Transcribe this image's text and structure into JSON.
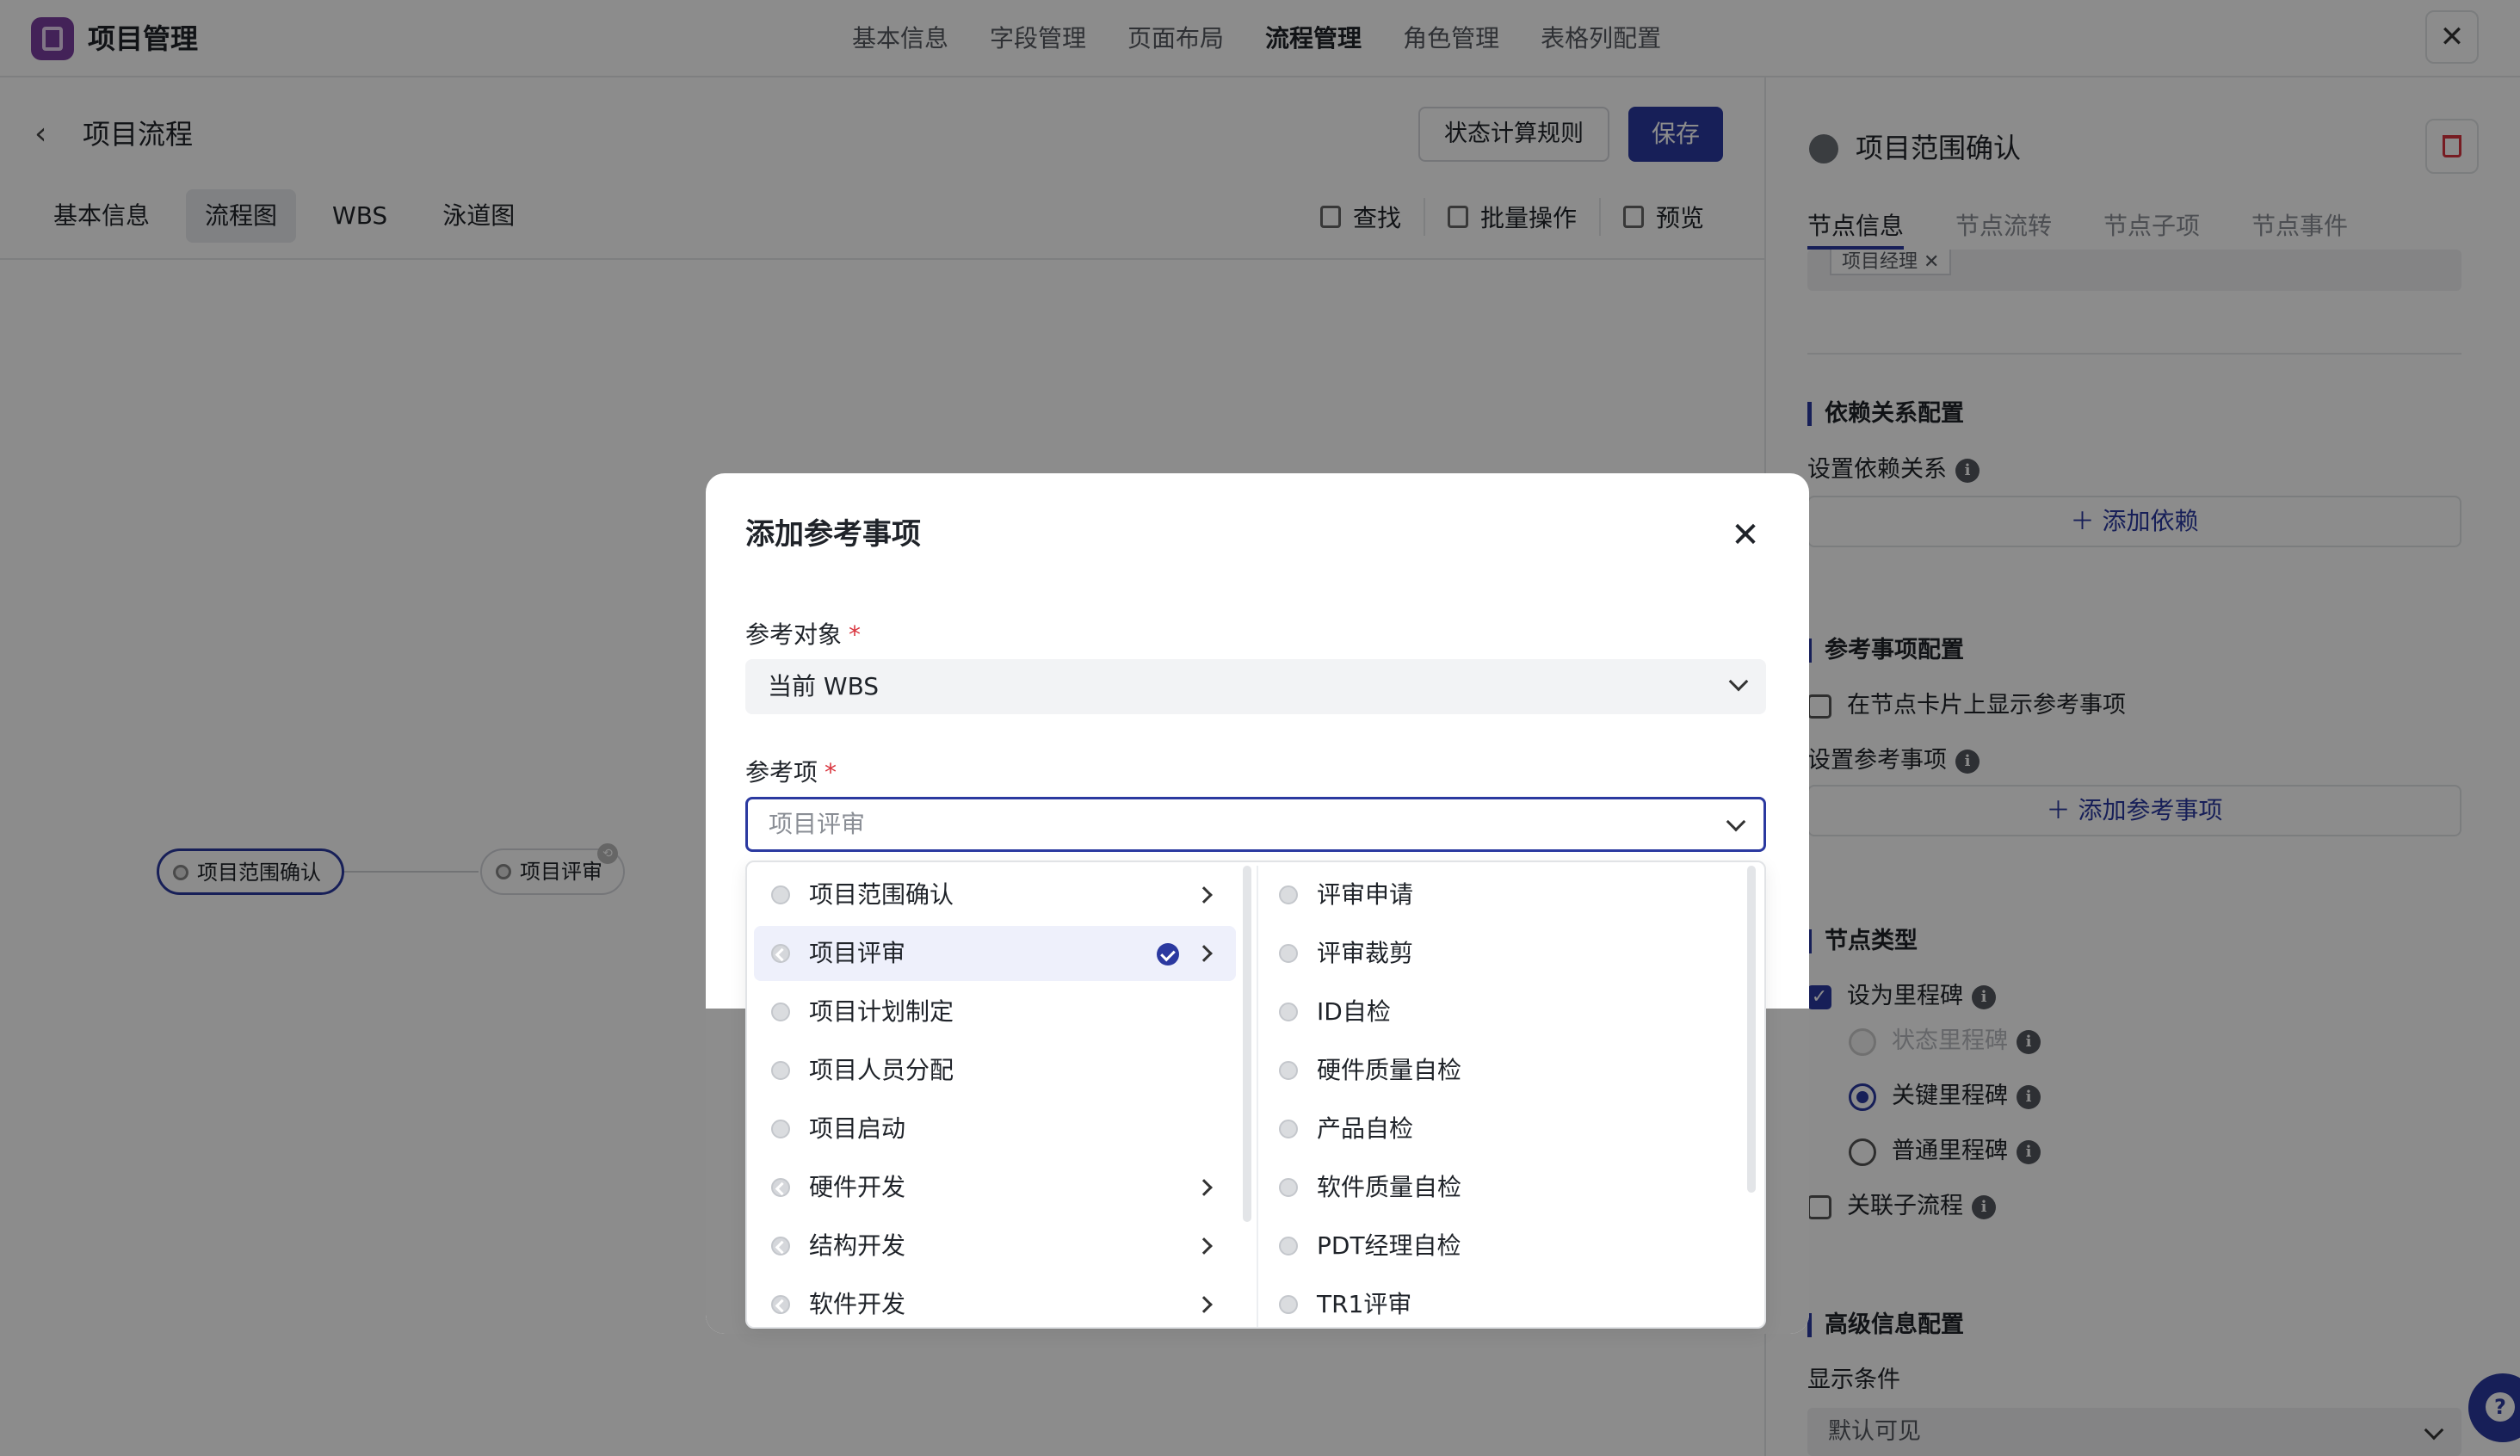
{
  "app": {
    "title": "项目管理"
  },
  "top_nav": [
    "基本信息",
    "字段管理",
    "页面布局",
    "流程管理",
    "角色管理",
    "表格列配置"
  ],
  "top_nav_active": "流程管理",
  "header": {
    "title": "项目流程",
    "rules_button": "状态计算规则",
    "save_button": "保存"
  },
  "sub_tabs": [
    "基本信息",
    "流程图",
    "WBS",
    "泳道图"
  ],
  "sub_tab_active": "流程图",
  "tools": [
    "查找",
    "批量操作",
    "预览"
  ],
  "canvas": {
    "nodes": [
      "项目范围确认",
      "项目评审"
    ]
  },
  "right_panel": {
    "title": "项目范围确认",
    "tabs": [
      "节点信息",
      "节点流转",
      "节点子项",
      "节点事件"
    ],
    "active_tab": "节点信息",
    "chip": "项目经理 ✕",
    "dependency": {
      "heading": "依赖关系配置",
      "label": "设置依赖关系",
      "add": "添加依赖"
    },
    "reference": {
      "heading": "参考事项配置",
      "show_on_card": "在节点卡片上显示参考事项",
      "label": "设置参考事项",
      "add": "添加参考事项"
    },
    "node_type": {
      "heading": "节点类型",
      "milestone": "设为里程碑",
      "status_ms": "状态里程碑",
      "key_ms": "关键里程碑",
      "normal_ms": "普通里程碑",
      "link_subflow": "关联子流程"
    },
    "advanced": {
      "heading": "高级信息配置",
      "label": "显示条件",
      "value": "默认可见"
    }
  },
  "modal": {
    "title": "添加参考事项",
    "field1_label": "参考对象",
    "field1_value": "当前 WBS",
    "field2_label": "参考项",
    "field2_placeholder": "项目评审",
    "left_options": [
      {
        "label": "项目范围确认",
        "has_children": true,
        "selected": false
      },
      {
        "label": "项目评审",
        "has_children": true,
        "selected": true
      },
      {
        "label": "项目计划制定",
        "has_children": false,
        "selected": false
      },
      {
        "label": "项目人员分配",
        "has_children": false,
        "selected": false
      },
      {
        "label": "项目启动",
        "has_children": false,
        "selected": false
      },
      {
        "label": "硬件开发",
        "has_children": true,
        "selected": false
      },
      {
        "label": "结构开发",
        "has_children": true,
        "selected": false
      },
      {
        "label": "软件开发",
        "has_children": true,
        "selected": false
      }
    ],
    "right_options": [
      "评审申请",
      "评审裁剪",
      "ID自检",
      "硬件质量自检",
      "产品自检",
      "软件质量自检",
      "PDT经理自检",
      "TR1评审"
    ]
  },
  "icons": [
    "app-logo-icon",
    "close-icon",
    "back-icon",
    "search-icon",
    "batch-icon",
    "preview-icon",
    "flag-icon",
    "trash-icon",
    "plus-icon",
    "info-icon",
    "chevron-down-icon",
    "chevron-right-icon",
    "check-icon",
    "help-icon"
  ],
  "colors": {
    "accent": "#2b39a0",
    "danger": "#d9343e",
    "overlay": "rgba(0,0,0,0.45)"
  }
}
